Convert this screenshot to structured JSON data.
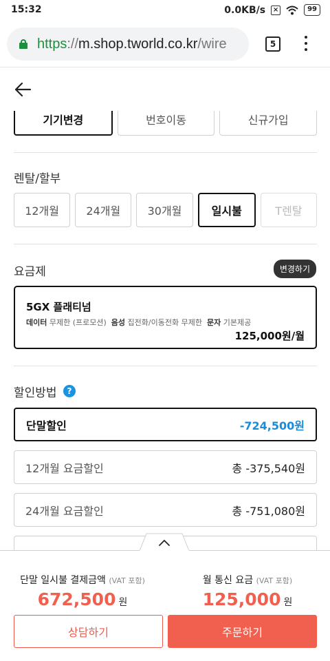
{
  "status_bar": {
    "time": "15:32",
    "network_speed": "0.0KB/s",
    "battery": "99"
  },
  "browser": {
    "url_scheme": "https",
    "url_separator": "://",
    "url_host": "m.shop.tworld.co.kr",
    "url_path": "/wire",
    "tab_count": "5"
  },
  "device_type_tabs": [
    {
      "label": "기기변경",
      "active": true
    },
    {
      "label": "번호이동",
      "active": false
    },
    {
      "label": "신규가입",
      "active": false
    }
  ],
  "rental": {
    "title": "렌탈/할부",
    "options": [
      {
        "label": "12개월",
        "state": "normal"
      },
      {
        "label": "24개월",
        "state": "normal"
      },
      {
        "label": "30개월",
        "state": "normal"
      },
      {
        "label": "일시불",
        "state": "active"
      },
      {
        "label": "T렌탈",
        "state": "disabled"
      }
    ]
  },
  "plan": {
    "title": "요금제",
    "change_label": "변경하기",
    "name": "5GX 플래티넘",
    "data_label": "데이터",
    "data_value": "무제한 (프로모션)",
    "voice_label": "음성",
    "voice_value": "집전화/이동전화 무제한",
    "sms_label": "문자",
    "sms_value": "기본제공",
    "price": "125,000원/월"
  },
  "discount": {
    "title": "할인방법",
    "help_symbol": "?",
    "rows": [
      {
        "label": "단말할인",
        "amount": "-724,500원",
        "active": true
      },
      {
        "label": "12개월 요금할인",
        "amount": "총 -375,540원",
        "active": false
      },
      {
        "label": "24개월 요금할인",
        "amount": "총 -751,080원",
        "active": false
      },
      {
        "label": "",
        "amount": "",
        "active": false
      }
    ]
  },
  "summary": {
    "device_payment_label": "단말 일시불 결제금액",
    "device_payment_vat": "(VAT 포함)",
    "device_payment_value": "672,500",
    "device_payment_unit": "원",
    "monthly_fee_label": "월 통신 요금",
    "monthly_fee_vat": "(VAT 포함)",
    "monthly_fee_value": "125,000",
    "monthly_fee_unit": "원",
    "consult_label": "상담하기",
    "order_label": "주문하기"
  },
  "colors": {
    "accent": "#f1604f",
    "discount_blue": "#1a8cd8",
    "help_blue": "#1a93e0",
    "secure_green": "#1e8e3e"
  }
}
